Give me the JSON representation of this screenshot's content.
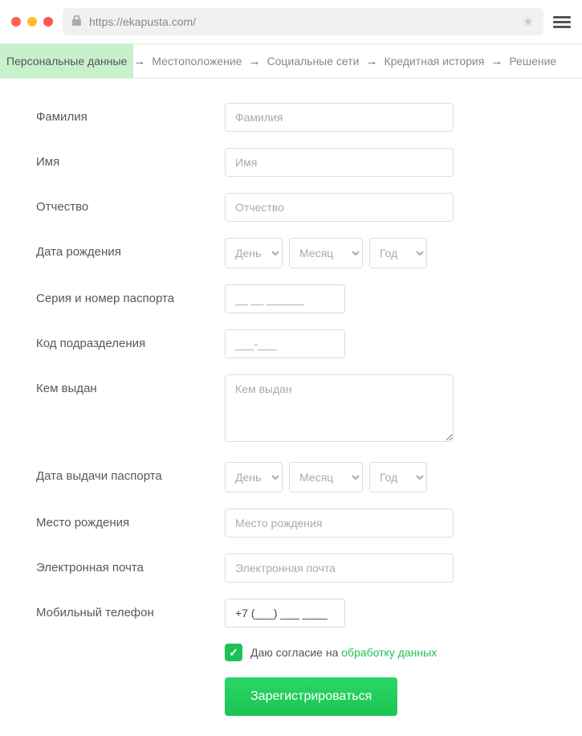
{
  "browser": {
    "url": "https://ekapusta.com/"
  },
  "steps": [
    "Персональные данные",
    "Местоположение",
    "Социальные сети",
    "Кредитная история",
    "Решение"
  ],
  "form": {
    "surname": {
      "label": "Фамилия",
      "placeholder": "Фамилия"
    },
    "name": {
      "label": "Имя",
      "placeholder": "Имя"
    },
    "patronymic": {
      "label": "Отчество",
      "placeholder": "Отчество"
    },
    "birthdate": {
      "label": "Дата рождения",
      "day": "День",
      "month": "Месяц",
      "year": "Год"
    },
    "passport_sn": {
      "label": "Серия и номер паспорта",
      "placeholder": "__ __ ______"
    },
    "dept_code": {
      "label": "Код подразделения",
      "placeholder": "___-___"
    },
    "issued_by": {
      "label": "Кем выдан",
      "placeholder": "Кем выдан"
    },
    "issue_date": {
      "label": "Дата выдачи паспорта",
      "day": "День",
      "month": "Месяц",
      "year": "Год"
    },
    "birthplace": {
      "label": "Место рождения",
      "placeholder": "Место рождения"
    },
    "email": {
      "label": "Электронная почта",
      "placeholder": "Электронная почта"
    },
    "phone": {
      "label": "Мобильный телефон",
      "value": "+7 (___) ___ ____"
    },
    "consent_prefix": "Даю согласие на ",
    "consent_link": "обработку данных",
    "submit": "Зарегистрироваться"
  }
}
